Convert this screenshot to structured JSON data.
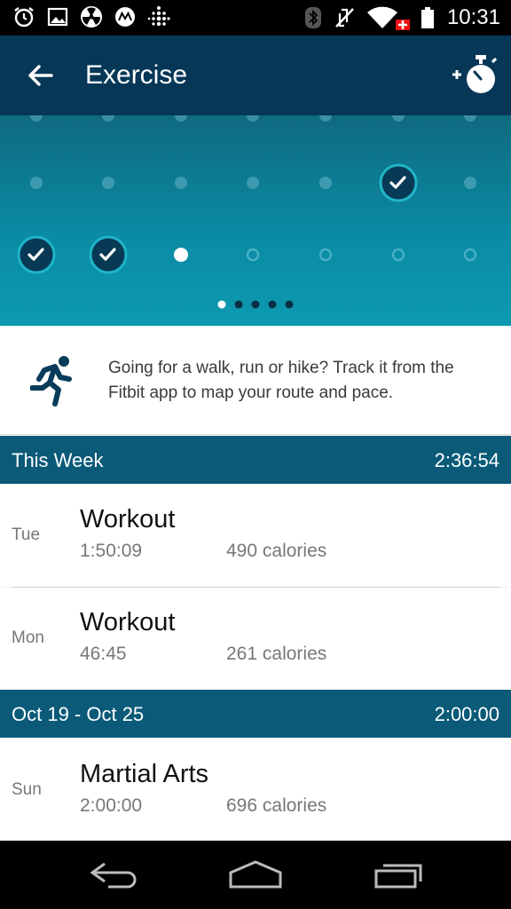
{
  "status_bar": {
    "time": "10:31",
    "left_icons": [
      "alarm-icon",
      "image-icon",
      "radiation-icon",
      "motorola-icon",
      "fitbit-icon"
    ],
    "right_icons": [
      "bluetooth-icon",
      "vibrate-off-icon",
      "wifi-icon",
      "battery-icon"
    ]
  },
  "header": {
    "title": "Exercise",
    "back_icon": "arrow-left-icon",
    "action_icon": "add-stopwatch-icon"
  },
  "chart": {
    "completed_columns_row2": [
      5
    ],
    "completed_columns_row3": [
      0,
      1
    ],
    "today_column": 2,
    "page_count": 5,
    "active_page": 0
  },
  "tip": {
    "icon": "runner-icon",
    "text": "Going for a walk, run or hike? Track it from the Fitbit app to map your route and pace."
  },
  "sections": [
    {
      "label": "This Week",
      "total": "2:36:54",
      "items": [
        {
          "day": "Tue",
          "name": "Workout",
          "duration": "1:50:09",
          "cal_value": "490",
          "cal_unit": "calories"
        },
        {
          "day": "Mon",
          "name": "Workout",
          "duration": "46:45",
          "cal_value": "261",
          "cal_unit": "calories"
        }
      ]
    },
    {
      "label": "Oct 19 - Oct 25",
      "total": "2:00:00",
      "items": [
        {
          "day": "Sun",
          "name": "Martial Arts",
          "duration": "2:00:00",
          "cal_value": "696",
          "cal_unit": "calories"
        }
      ]
    }
  ],
  "nav": {
    "back": "nav-back-icon",
    "home": "nav-home-icon",
    "recents": "nav-recents-icon"
  },
  "colors": {
    "appbar": "#063756",
    "section": "#0a5a78",
    "chart_top": "#0f6a7f",
    "chart_bottom": "#0d9ab1"
  }
}
